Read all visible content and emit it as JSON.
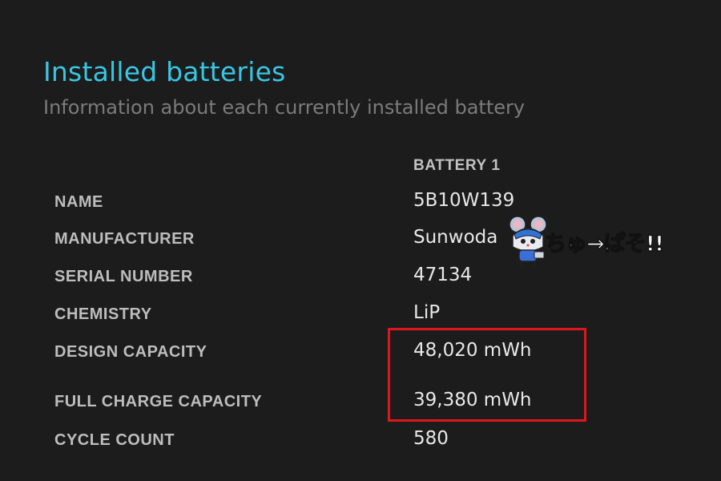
{
  "header": {
    "title": "Installed batteries",
    "subtitle": "Information about each currently installed battery"
  },
  "table": {
    "column_header": "BATTERY 1",
    "rows": [
      {
        "label": "NAME",
        "value": "5B10W139"
      },
      {
        "label": "MANUFACTURER",
        "value": "Sunwoda"
      },
      {
        "label": "SERIAL NUMBER",
        "value": "47134"
      },
      {
        "label": "CHEMISTRY",
        "value": "LiP"
      },
      {
        "label": "DESIGN CAPACITY",
        "value": "48,020 mWh"
      },
      {
        "label": "FULL CHARGE CAPACITY",
        "value": "39,380 mWh"
      },
      {
        "label": "CYCLE COUNT",
        "value": "580"
      }
    ]
  },
  "highlight": {
    "color": "#e0161c"
  },
  "watermark": {
    "text": "ちゅ→ぱそ!!",
    "icon": "mouse-mascot-icon"
  }
}
